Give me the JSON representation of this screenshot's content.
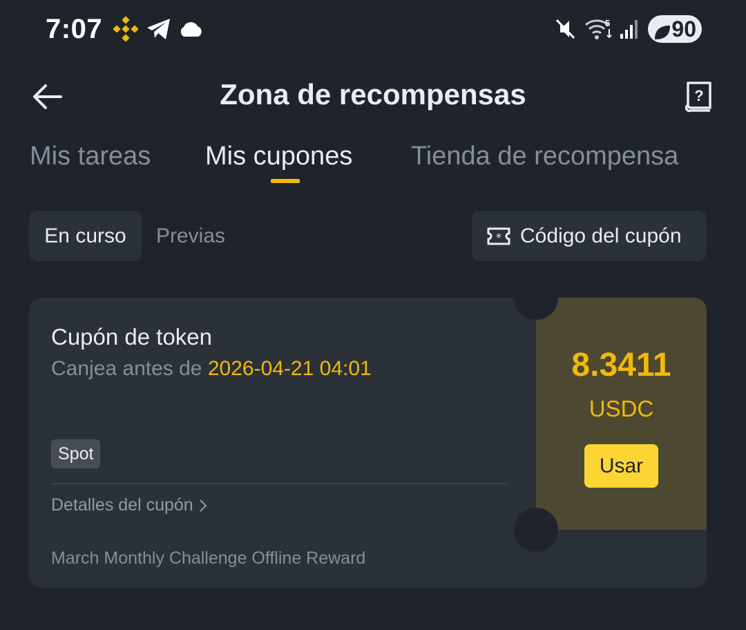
{
  "status_bar": {
    "time": "7:07",
    "battery": "90",
    "icons": [
      "binance-icon",
      "telegram-icon",
      "cloud-icon",
      "mute-icon",
      "wifi-icon",
      "signal-icon",
      "battery-icon"
    ],
    "wifi_badge": "5"
  },
  "header": {
    "title": "Zona de recompensas",
    "back_icon": "arrow-left-icon",
    "help_icon": "help-book-icon"
  },
  "tabs": [
    {
      "label": "Mis tareas",
      "active": false
    },
    {
      "label": "Mis cupones",
      "active": true
    },
    {
      "label": "Tienda de recompensa",
      "active": false
    }
  ],
  "filters": {
    "active": "En curso",
    "inactive": "Previas",
    "code_button": "Código del cupón"
  },
  "coupon": {
    "title": "Cupón de token",
    "expiry_prefix": "Canjea antes de",
    "expiry_date": "2026-04-21 04:01",
    "badge": "Spot",
    "details_label": "Detalles del cupón",
    "campaign": "March Monthly Challenge Offline Reward",
    "amount": "8.3411",
    "unit": "USDC",
    "use_button": "Usar"
  },
  "colors": {
    "background": "#1f232b",
    "card": "#2b3139",
    "accent": "#f0b90b",
    "button_yellow": "#fcd535",
    "coupon_panel": "#4d4831"
  }
}
